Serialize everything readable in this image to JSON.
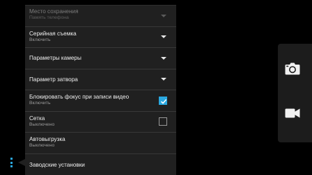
{
  "settings": {
    "rows": [
      {
        "title": "Место сохранения",
        "subtitle": "Память телефона",
        "control": "dropdown",
        "enabled": false
      },
      {
        "title": "Серийная съемка",
        "subtitle": "Включить",
        "control": "dropdown",
        "enabled": true
      },
      {
        "title": "Параметры камеры",
        "subtitle": "",
        "control": "dropdown",
        "enabled": true
      },
      {
        "title": "Параметр затвора",
        "subtitle": "",
        "control": "dropdown",
        "enabled": true
      },
      {
        "title": "Блокировать фокус при записи видео",
        "subtitle": "Включить",
        "control": "checkbox",
        "checked": true,
        "enabled": true
      },
      {
        "title": "Сетка",
        "subtitle": "Выключено",
        "control": "checkbox",
        "checked": false,
        "enabled": true
      },
      {
        "title": "Автовыгрузка",
        "subtitle": "Выключено",
        "control": "none",
        "enabled": true
      },
      {
        "title": "Заводские установки",
        "subtitle": "",
        "control": "none",
        "enabled": true
      }
    ]
  },
  "mode_bar": {
    "icons": [
      "camera-icon",
      "video-camera-icon"
    ]
  },
  "colors": {
    "accent": "#2aa8e0",
    "panel": "#202020",
    "background": "#000000"
  }
}
